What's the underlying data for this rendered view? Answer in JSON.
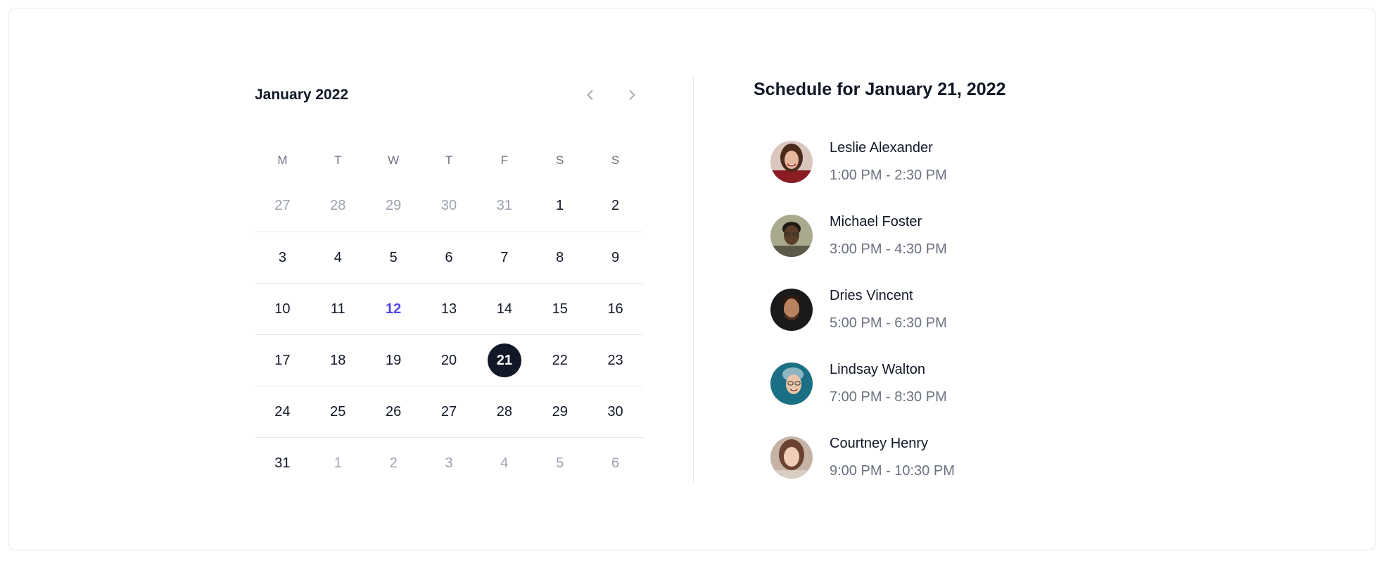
{
  "calendar": {
    "month_label": "January 2022",
    "prev_icon": "chevron-left-icon",
    "next_icon": "chevron-right-icon",
    "weekdays": [
      "M",
      "T",
      "W",
      "T",
      "F",
      "S",
      "S"
    ],
    "weeks": [
      [
        "27",
        "28",
        "29",
        "30",
        "31",
        "1",
        "2"
      ],
      [
        "3",
        "4",
        "5",
        "6",
        "7",
        "8",
        "9"
      ],
      [
        "10",
        "11",
        "12",
        "13",
        "14",
        "15",
        "16"
      ],
      [
        "17",
        "18",
        "19",
        "20",
        "21",
        "22",
        "23"
      ],
      [
        "24",
        "25",
        "26",
        "27",
        "28",
        "29",
        "30"
      ],
      [
        "31",
        "1",
        "2",
        "3",
        "4",
        "5",
        "6"
      ]
    ],
    "today": "12",
    "selected": "21"
  },
  "schedule": {
    "title": "Schedule for January 21, 2022",
    "meetings": [
      {
        "name": "Leslie Alexander",
        "time": "1:00 PM - 2:30 PM"
      },
      {
        "name": "Michael Foster",
        "time": "3:00 PM - 4:30 PM"
      },
      {
        "name": "Dries Vincent",
        "time": "5:00 PM - 6:30 PM"
      },
      {
        "name": "Lindsay Walton",
        "time": "7:00 PM - 8:30 PM"
      },
      {
        "name": "Courtney Henry",
        "time": "9:00 PM - 10:30 PM"
      }
    ]
  },
  "colors": {
    "accent": "#4f46e5",
    "selected_bg": "#111827",
    "muted_text": "#9ca3af",
    "secondary_text": "#6b7280",
    "border": "#e5e7eb"
  }
}
